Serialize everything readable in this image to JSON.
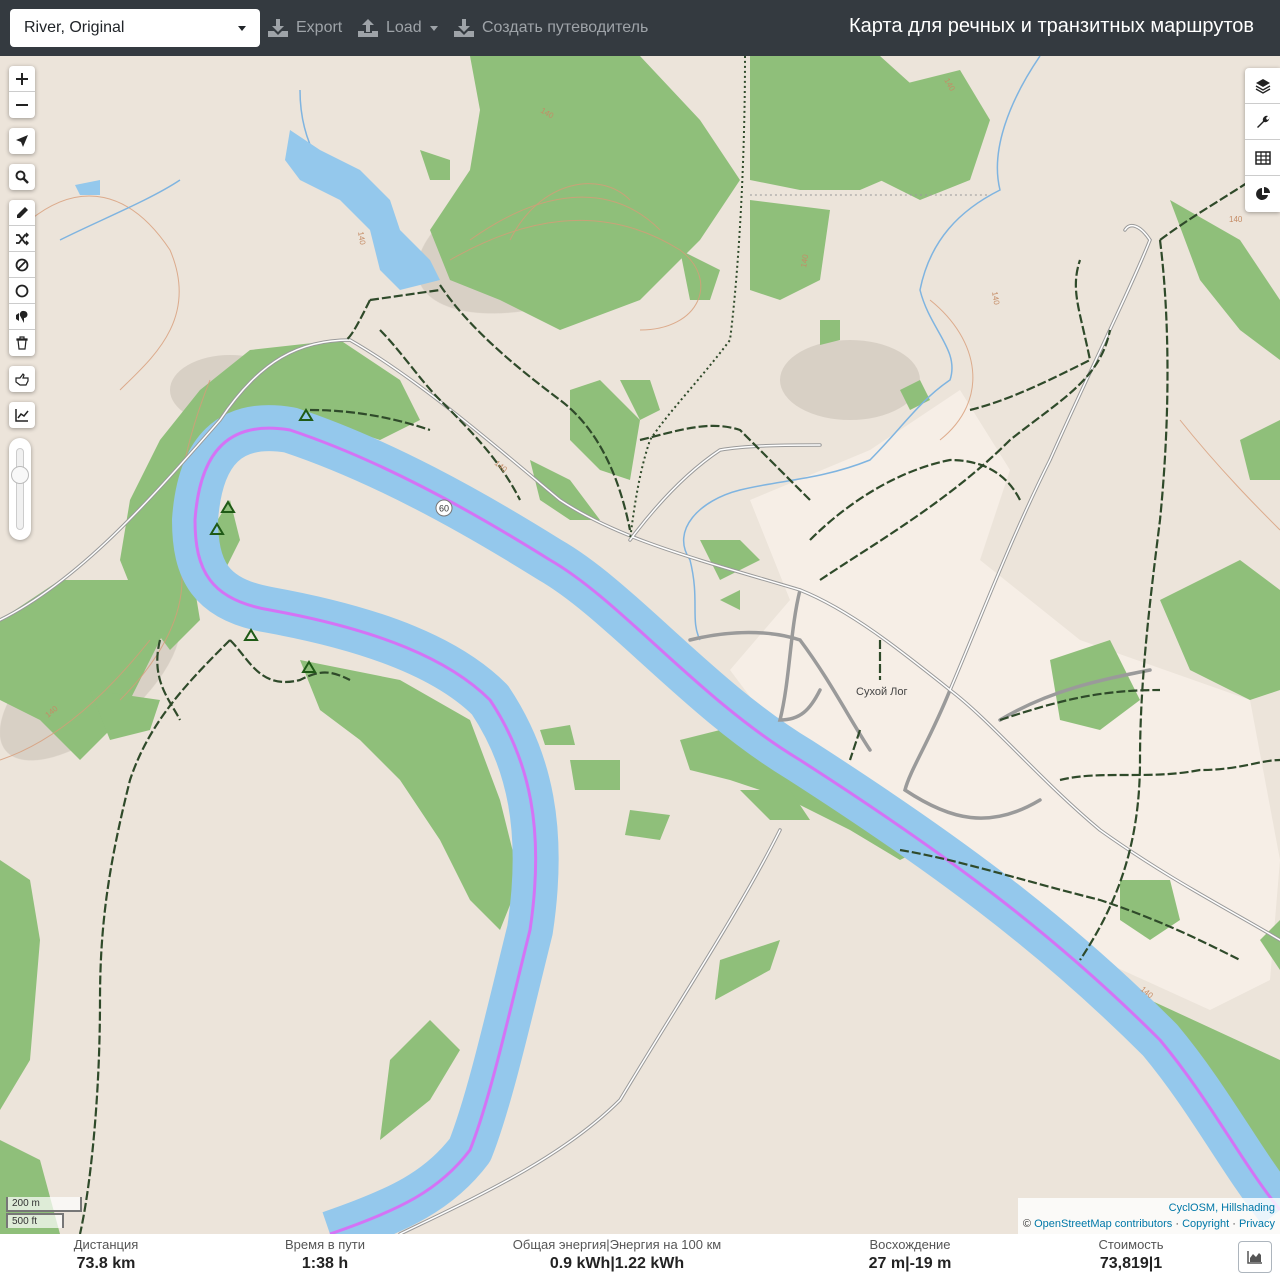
{
  "navbar": {
    "profile_selected": "River, Original",
    "export_label": "Export",
    "load_label": "Load",
    "guide_label": "Создать путеводитель",
    "app_title": "Карта для речных и транзитных маршрутов"
  },
  "map": {
    "place_label": "Сухой Лог",
    "route_shield": "60",
    "contour_labels": [
      "140",
      "140",
      "140",
      "140",
      "140",
      "140",
      "140",
      "140",
      "140"
    ],
    "scale_metric": "200 m",
    "scale_imperial": "500 ft",
    "attribution": {
      "line1": "CyclOSM, Hillshading",
      "osm_prefix": "©",
      "osm_link": "OpenStreetMap contributors",
      "sep": "·",
      "copyright": "Copyright",
      "privacy": "Privacy"
    },
    "colors": {
      "land": "#ece4da",
      "forest": "#8fbf7a",
      "water": "#94c8ec",
      "route": "#d473f5",
      "residential": "#f6eee6"
    }
  },
  "footer": {
    "distance": {
      "label": "Дистанция",
      "value": "73.8",
      "unit": "km"
    },
    "duration": {
      "label": "Время в пути",
      "value": "1:38",
      "unit": "h"
    },
    "energy": {
      "label": "Общая энергия",
      "label2": "Энергия на 100 км",
      "value": "0.9",
      "unit": "kWh",
      "value2": "1.22",
      "unit2": "kWh",
      "sep": "|"
    },
    "ascent": {
      "label": "Восхождение",
      "value": "27",
      "unit": "m",
      "value2": "-19",
      "unit2": "m",
      "sep": "|"
    },
    "cost": {
      "label": "Стоимость",
      "value": "73,819",
      "value2": "1",
      "sep": "|"
    }
  }
}
